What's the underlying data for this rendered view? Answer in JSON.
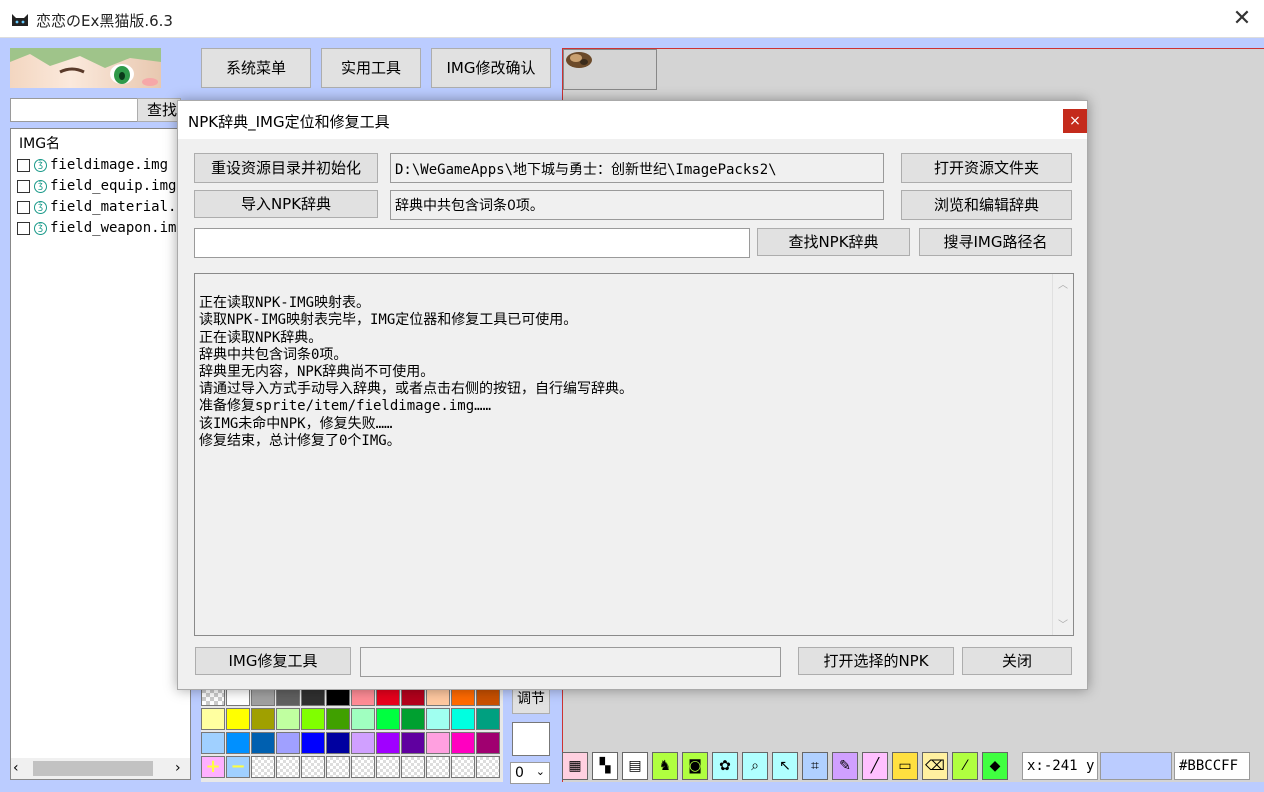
{
  "window": {
    "title": "恋恋のEx黑猫版.6.3",
    "close_glyph": "✕"
  },
  "top_buttons": {
    "system_menu": "系统菜单",
    "tools": "实用工具",
    "img_confirm": "IMG修改确认"
  },
  "search": {
    "value": "",
    "button": "查找"
  },
  "file_list": {
    "header": "IMG名",
    "items": [
      {
        "name": "fieldimage.img"
      },
      {
        "name": "field_equip.img"
      },
      {
        "name": "field_material.img"
      },
      {
        "name": "field_weapon.img"
      }
    ]
  },
  "dialog": {
    "title": "NPK辞典_IMG定位和修复工具",
    "close_glyph": "×",
    "reset_button": "重设资源目录并初始化",
    "path_value": "D:\\WeGameApps\\地下城与勇士：创新世纪\\ImagePacks2\\",
    "open_folder_button": "打开资源文件夹",
    "import_button": "导入NPK辞典",
    "dict_status": "辞典中共包含词条0项。",
    "browse_button": "浏览和编辑辞典",
    "query_value": "",
    "find_npk_button": "查找NPK辞典",
    "search_img_button": "搜寻IMG路径名",
    "log_lines": [
      "正在读取NPK-IMG映射表。",
      "读取NPK-IMG映射表完毕，IMG定位器和修复工具已可使用。",
      "正在读取NPK辞典。",
      "辞典中共包含词条0项。",
      "辞典里无内容，NPK辞典尚不可使用。",
      "请通过导入方式手动导入辞典，或者点击右侧的按钮，自行编写辞典。",
      "准备修复sprite/item/fieldimage.img……",
      "该IMG未命中NPK，修复失败……",
      "修复结束，总计修复了0个IMG。"
    ],
    "img_repair_button": "IMG修复工具",
    "bottom_value": "",
    "open_npk_button": "打开选择的NPK",
    "close_button": "关闭"
  },
  "color_tools": {
    "adjust_button": "调节",
    "opacity_value": "0"
  },
  "palette_colors": [
    "#ffffff",
    "#a0a0a0",
    "#606060",
    "#303030",
    "#000000",
    "#ff8c96",
    "#e8001c",
    "#b4001c",
    "#ffc8a0",
    "#ff6a00",
    "#c85000",
    "#ffffa0",
    "#ffff00",
    "#a0a000",
    "#c0ffa0",
    "#80ff00",
    "#40a000",
    "#a0ffc0",
    "#00ff40",
    "#00a030",
    "#a0fff0",
    "#00ffe0",
    "#00a080",
    "#a0d0ff",
    "#0090ff",
    "#0060b0",
    "#a0a0ff",
    "#0000ff",
    "#0000a0",
    "#d0a0ff",
    "#a000ff",
    "#6000a0",
    "#ffa0e0",
    "#ff00c0",
    "#a00070"
  ],
  "status": {
    "coords": "x:-241 y",
    "color_hex": "#BBCCFF"
  }
}
